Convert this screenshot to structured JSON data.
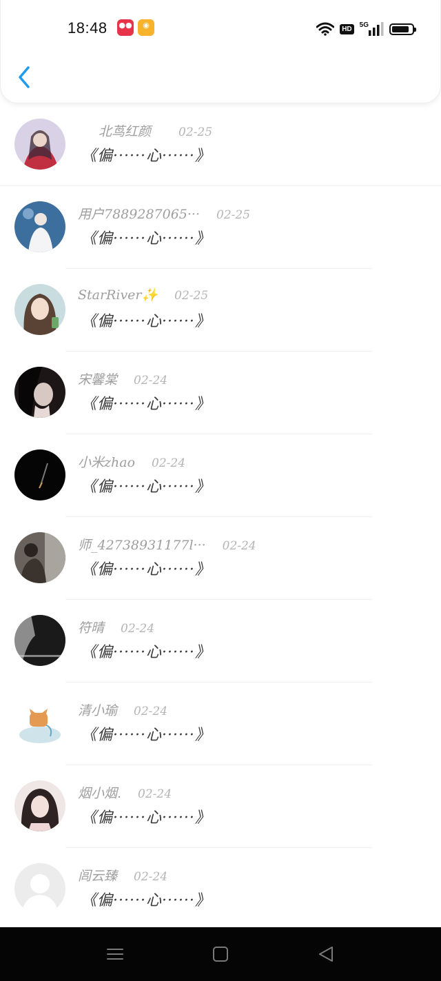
{
  "status_bar": {
    "time": "18:48",
    "network": "5G",
    "hd": "HD"
  },
  "items": [
    {
      "name": "北茑红颜",
      "date": "02-25",
      "comment": "《偏······心······》",
      "avatar_color": "#b9a7c8"
    },
    {
      "name": "用户7889287065···",
      "date": "02-25",
      "comment": "《偏······心······》",
      "avatar_color": "#5a86b0"
    },
    {
      "name": "StarRiver✨",
      "date": "02-25",
      "comment": "《偏······心······》",
      "avatar_color": "#b39c86"
    },
    {
      "name": "宋馨棠",
      "date": "02-24",
      "comment": "《偏······心······》",
      "avatar_color": "#4a3c3a"
    },
    {
      "name": "小米zhao",
      "date": "02-24",
      "comment": "《偏······心······》",
      "avatar_color": "#0a0a0a"
    },
    {
      "name": "师_42738931177l···",
      "date": "02-24",
      "comment": "《偏······心······》",
      "avatar_color": "#4b4540"
    },
    {
      "name": "符晴",
      "date": "02-24",
      "comment": "《偏······心······》",
      "avatar_color": "#2c2c2c"
    },
    {
      "name": "清小瑜",
      "date": "02-24",
      "comment": "《偏······心······》",
      "avatar_color": "#e7eef0"
    },
    {
      "name": "烟小烟.",
      "date": "02-24",
      "comment": "《偏······心······》",
      "avatar_color": "#8a6a6a"
    },
    {
      "name": "闾云臻",
      "date": "02-24",
      "comment": "《偏······心······》",
      "avatar_color": "#e3e3e3"
    }
  ],
  "icons": {
    "back": "chevron-left-icon",
    "nav_menu": "menu-icon",
    "nav_home": "home-square-icon",
    "nav_back": "triangle-back-icon"
  },
  "colors": {
    "accent": "#1e9bf0",
    "nav_bar": "#050505"
  }
}
